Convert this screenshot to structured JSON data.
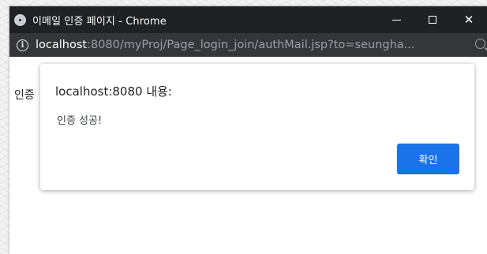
{
  "window": {
    "title": "이메일 인증 페이지 - Chrome",
    "controls": {
      "close": "✕"
    }
  },
  "address_bar": {
    "host": "localhost",
    "rest": ":8080/myProj/Page_login_join/authMail.jsp?to=seungha..."
  },
  "page": {
    "partial_text": "인증"
  },
  "dialog": {
    "title": "localhost:8080 내용:",
    "message": "인증 성공!",
    "ok_label": "확인"
  },
  "colors": {
    "titlebar": "#202124",
    "urlbar": "#35363a",
    "accent": "#1a73e8"
  }
}
